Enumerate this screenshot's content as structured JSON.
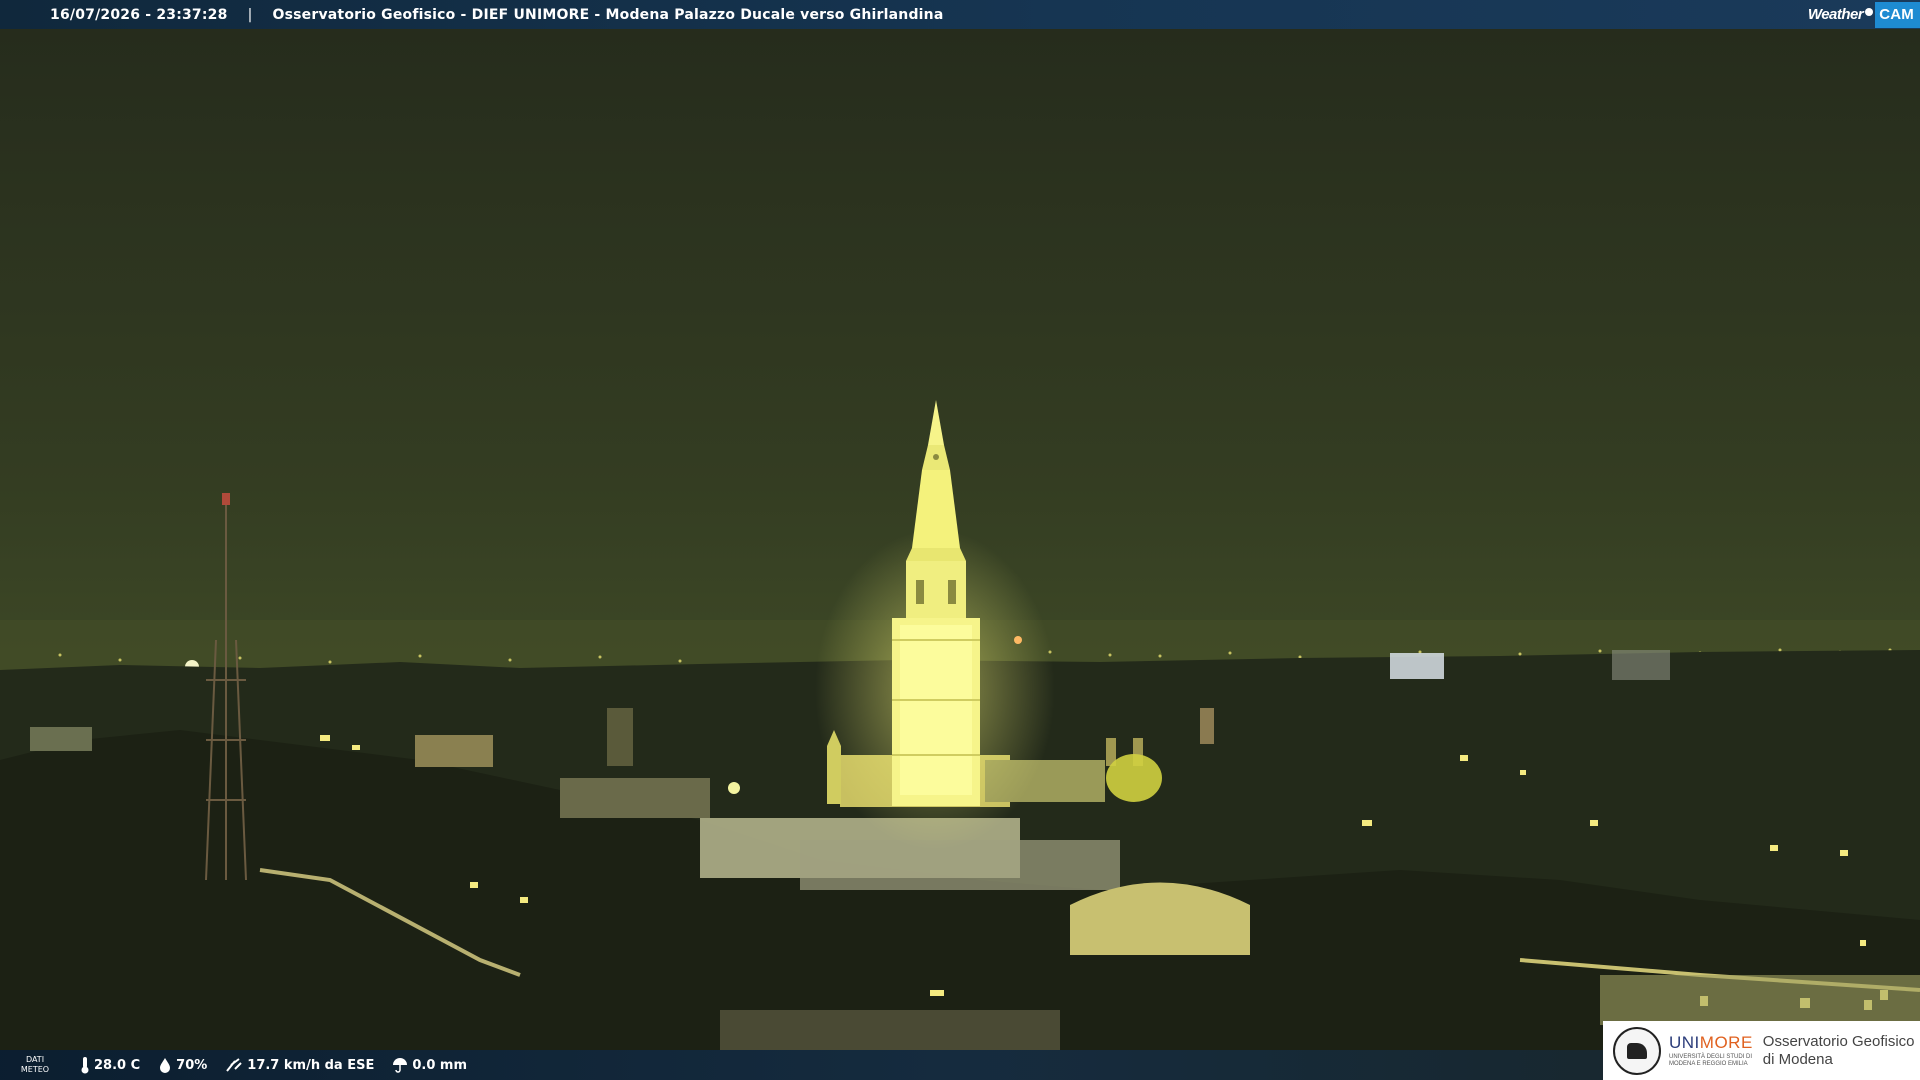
{
  "header": {
    "timestamp": "16/07/2026 - 23:37:28",
    "separator": "|",
    "title": "Osservatorio Geofisico - DIEF UNIMORE - Modena Palazzo Ducale verso Ghirlandina"
  },
  "logo": {
    "weather": "Weather",
    "cam": "CAM"
  },
  "meteo": {
    "label_line1": "DATI",
    "label_line2": "METEO",
    "temperature": "28.0 C",
    "humidity": "70%",
    "wind": "17.7 km/h da ESE",
    "rain": "0.0 mm"
  },
  "unimore": {
    "brand_uni": "UNI",
    "brand_more": "MORE",
    "sub_line1": "UNIVERSITÀ DEGLI STUDI DI",
    "sub_line2": "MODENA E REGGIO EMILIA",
    "obs_line1": "Osservatorio Geofisico",
    "obs_line2": "di Modena"
  },
  "icons": {
    "temperature": "thermometer-icon",
    "humidity": "droplet-icon",
    "wind": "wind-icon",
    "rain": "umbrella-icon"
  },
  "colors": {
    "sky": "#3a4426",
    "tower_light": "#ffff9a",
    "header_bg": "#163552",
    "cam_blue": "#1e8bd2",
    "unimore_blue": "#2b3c7a",
    "unimore_orange": "#e0611f"
  }
}
